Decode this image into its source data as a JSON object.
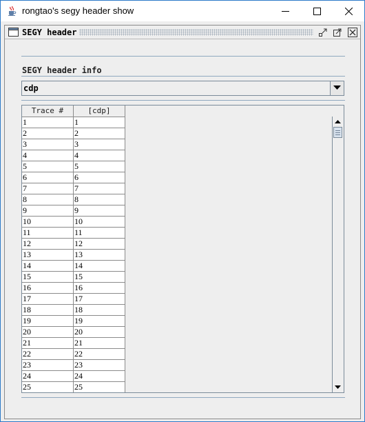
{
  "window": {
    "title": "rongtao's segy header show",
    "icons": {
      "app": "java-cup-icon",
      "minimize": "minimize-icon",
      "maximize": "maximize-icon",
      "close": "close-icon"
    }
  },
  "internal_frame": {
    "title": "SEGY header",
    "icons": {
      "frame": "window-icon",
      "iconify": "iconify-icon",
      "maximize": "frame-maximize-icon",
      "close": "frame-close-icon"
    }
  },
  "section": {
    "title": "SEGY header info"
  },
  "combo": {
    "selected": "cdp",
    "icon": "chevron-down-icon"
  },
  "table": {
    "columns": [
      "Trace #",
      "[cdp]"
    ],
    "rows": [
      [
        "1",
        "1"
      ],
      [
        "2",
        "2"
      ],
      [
        "3",
        "3"
      ],
      [
        "4",
        "4"
      ],
      [
        "5",
        "5"
      ],
      [
        "6",
        "6"
      ],
      [
        "7",
        "7"
      ],
      [
        "8",
        "8"
      ],
      [
        "9",
        "9"
      ],
      [
        "10",
        "10"
      ],
      [
        "11",
        "11"
      ],
      [
        "12",
        "12"
      ],
      [
        "13",
        "13"
      ],
      [
        "14",
        "14"
      ],
      [
        "15",
        "15"
      ],
      [
        "16",
        "16"
      ],
      [
        "17",
        "17"
      ],
      [
        "18",
        "18"
      ],
      [
        "19",
        "19"
      ],
      [
        "20",
        "20"
      ],
      [
        "21",
        "21"
      ],
      [
        "22",
        "22"
      ],
      [
        "23",
        "23"
      ],
      [
        "24",
        "24"
      ],
      [
        "25",
        "25"
      ]
    ]
  },
  "colors": {
    "window_border": "#2b79c8",
    "panel_bg": "#eeeeee",
    "rule": "#8fa8bf",
    "grid": "#8a8a8a"
  }
}
